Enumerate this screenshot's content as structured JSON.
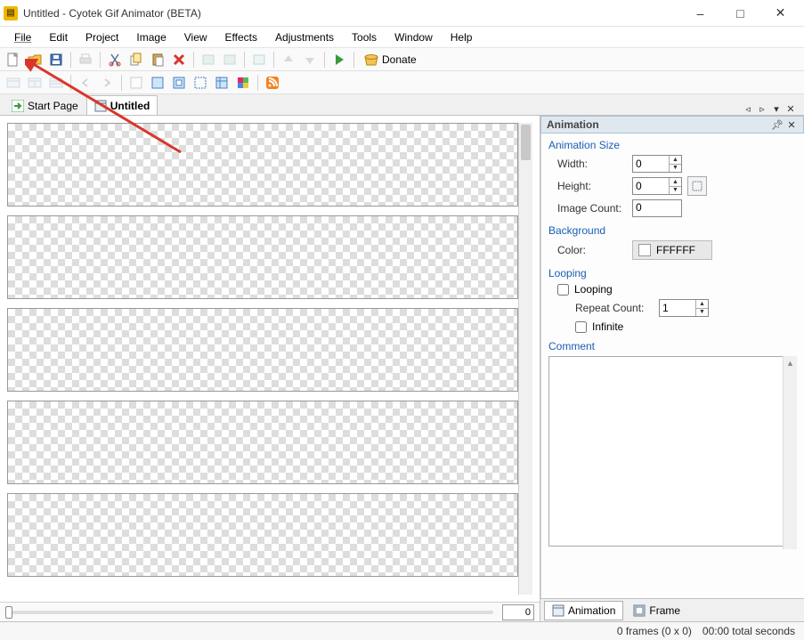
{
  "titlebar": {
    "title": "Untitled - Cyotek Gif Animator (BETA)"
  },
  "menu": {
    "items": [
      "File",
      "Edit",
      "Project",
      "Image",
      "View",
      "Effects",
      "Adjustments",
      "Tools",
      "Window",
      "Help"
    ]
  },
  "toolbar1": {
    "donate_label": "Donate"
  },
  "tabs": {
    "start": {
      "label": "Start Page"
    },
    "untitled": {
      "label": "Untitled"
    }
  },
  "editor": {
    "zoom": "0"
  },
  "panel": {
    "title": "Animation",
    "animation_size": {
      "title": "Animation Size",
      "width_label": "Width:",
      "width_value": "0",
      "height_label": "Height:",
      "height_value": "0",
      "image_count_label": "Image Count:",
      "image_count_value": "0"
    },
    "background": {
      "title": "Background",
      "color_label": "Color:",
      "color_hex": "FFFFFF"
    },
    "looping": {
      "title": "Looping",
      "looping_label": "Looping",
      "looping_checked": false,
      "repeat_label": "Repeat Count:",
      "repeat_value": "1",
      "infinite_label": "Infinite",
      "infinite_checked": false
    },
    "comment": {
      "title": "Comment",
      "value": ""
    },
    "tabs": {
      "animation": "Animation",
      "frame": "Frame"
    }
  },
  "statusbar": {
    "frames": "0 frames (0 x 0)",
    "time": "00:00 total seconds"
  }
}
